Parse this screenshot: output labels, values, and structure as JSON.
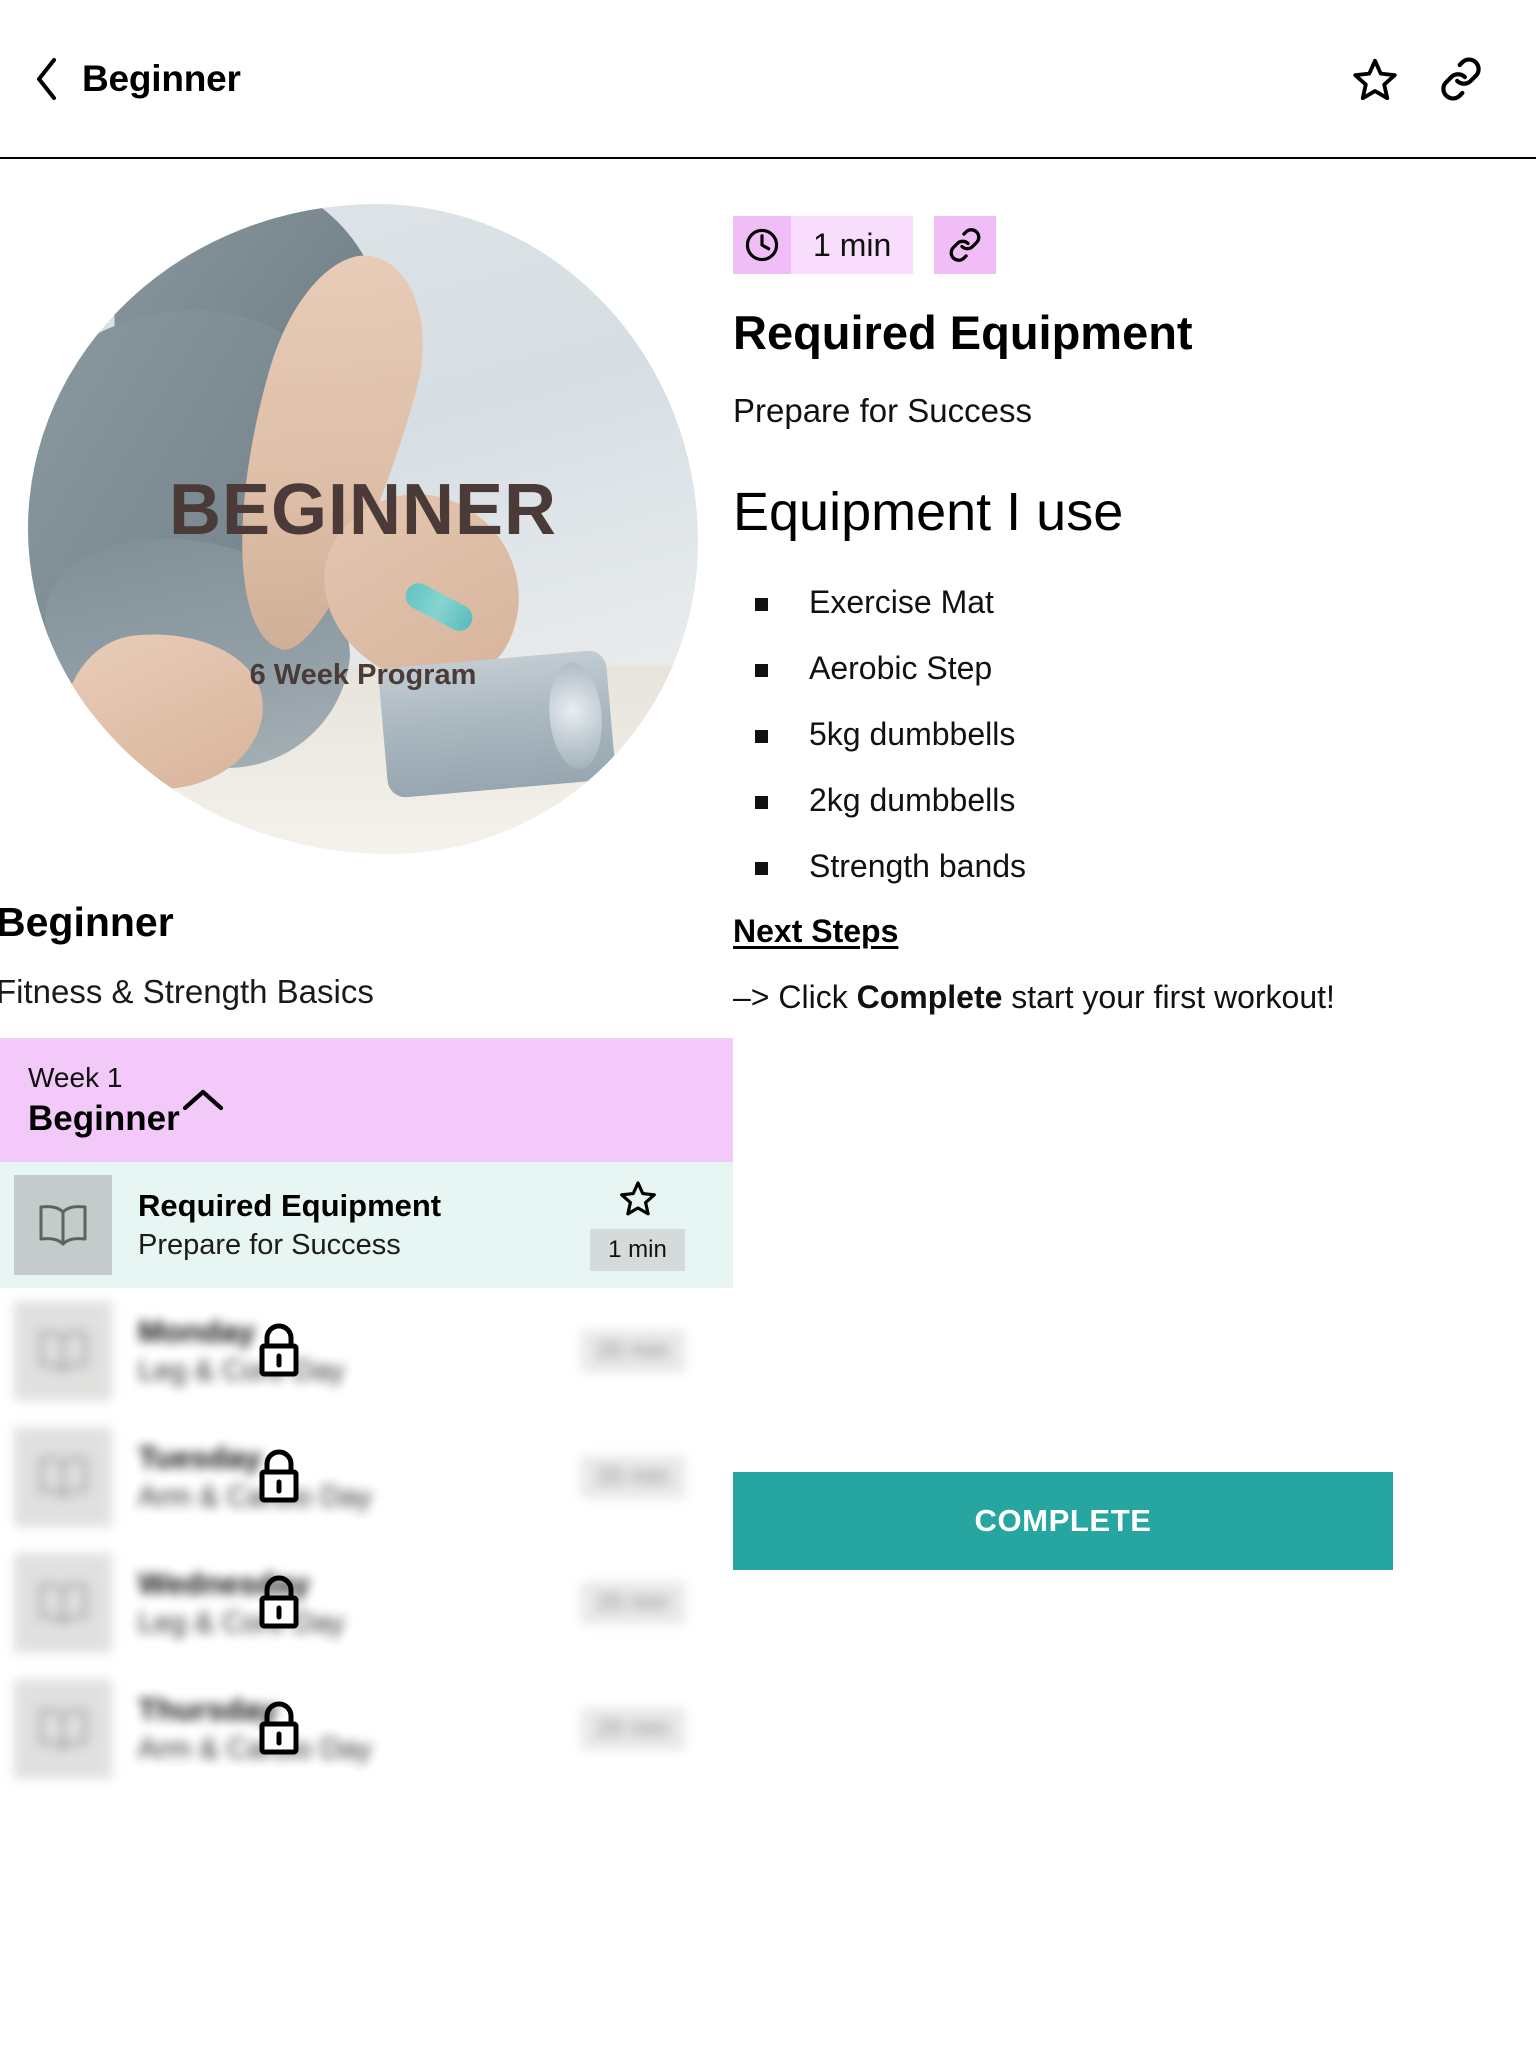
{
  "topbar": {
    "back_icon": "chevron-left-icon",
    "title": "Beginner",
    "favorite_icon": "star-icon",
    "share_icon": "link-icon"
  },
  "hero": {
    "overlay_title": "BEGINNER",
    "overlay_subtitle": "6 Week Program"
  },
  "program": {
    "title": "Beginner",
    "subtitle": "Fitness & Strength Basics"
  },
  "week": {
    "label": "Week 1",
    "name": "Beginner",
    "collapse_icon": "chevron-up-icon"
  },
  "lessons": [
    {
      "title": "Required Equipment",
      "subtitle": "Prepare for Success",
      "duration": "1 min",
      "state": "active",
      "thumb_icon": "book-icon",
      "star_icon": "star-icon"
    },
    {
      "title": "Monday",
      "subtitle": "Leg & Core Day",
      "duration": "20 min",
      "state": "locked",
      "thumb_icon": "book-icon",
      "lock_icon": "lock-icon"
    },
    {
      "title": "Tuesday",
      "subtitle": "Arm & Cardio Day",
      "duration": "20 min",
      "state": "locked",
      "thumb_icon": "book-icon",
      "lock_icon": "lock-icon"
    },
    {
      "title": "Wednesday",
      "subtitle": "Leg & Core Day",
      "duration": "20 min",
      "state": "locked",
      "thumb_icon": "book-icon",
      "lock_icon": "lock-icon"
    },
    {
      "title": "Thursday",
      "subtitle": "Arm & Cardio Day",
      "duration": "20 min",
      "state": "locked",
      "thumb_icon": "book-icon",
      "lock_icon": "lock-icon"
    }
  ],
  "detail": {
    "duration_badge": "1 min",
    "clock_icon": "clock-icon",
    "link_icon": "link-icon",
    "title": "Required Equipment",
    "subtitle": "Prepare for Success",
    "section_heading": "Equipment I use",
    "equipment": [
      "Exercise Mat",
      "Aerobic Step",
      "5kg dumbbells",
      "2kg dumbbells",
      "Strength bands"
    ],
    "next_steps_heading": "Next Steps",
    "next_steps_prefix": "–> Click ",
    "next_steps_bold": "Complete",
    "next_steps_suffix": " start your first workout!",
    "complete_button": "COMPLETE"
  },
  "colors": {
    "accent_pink": "#f3c9fa",
    "badge_pink_dark": "#f0bdf6",
    "badge_pink_light": "#f9ddfc",
    "active_row": "#e8f6f3",
    "complete_teal": "#27a5a0"
  }
}
